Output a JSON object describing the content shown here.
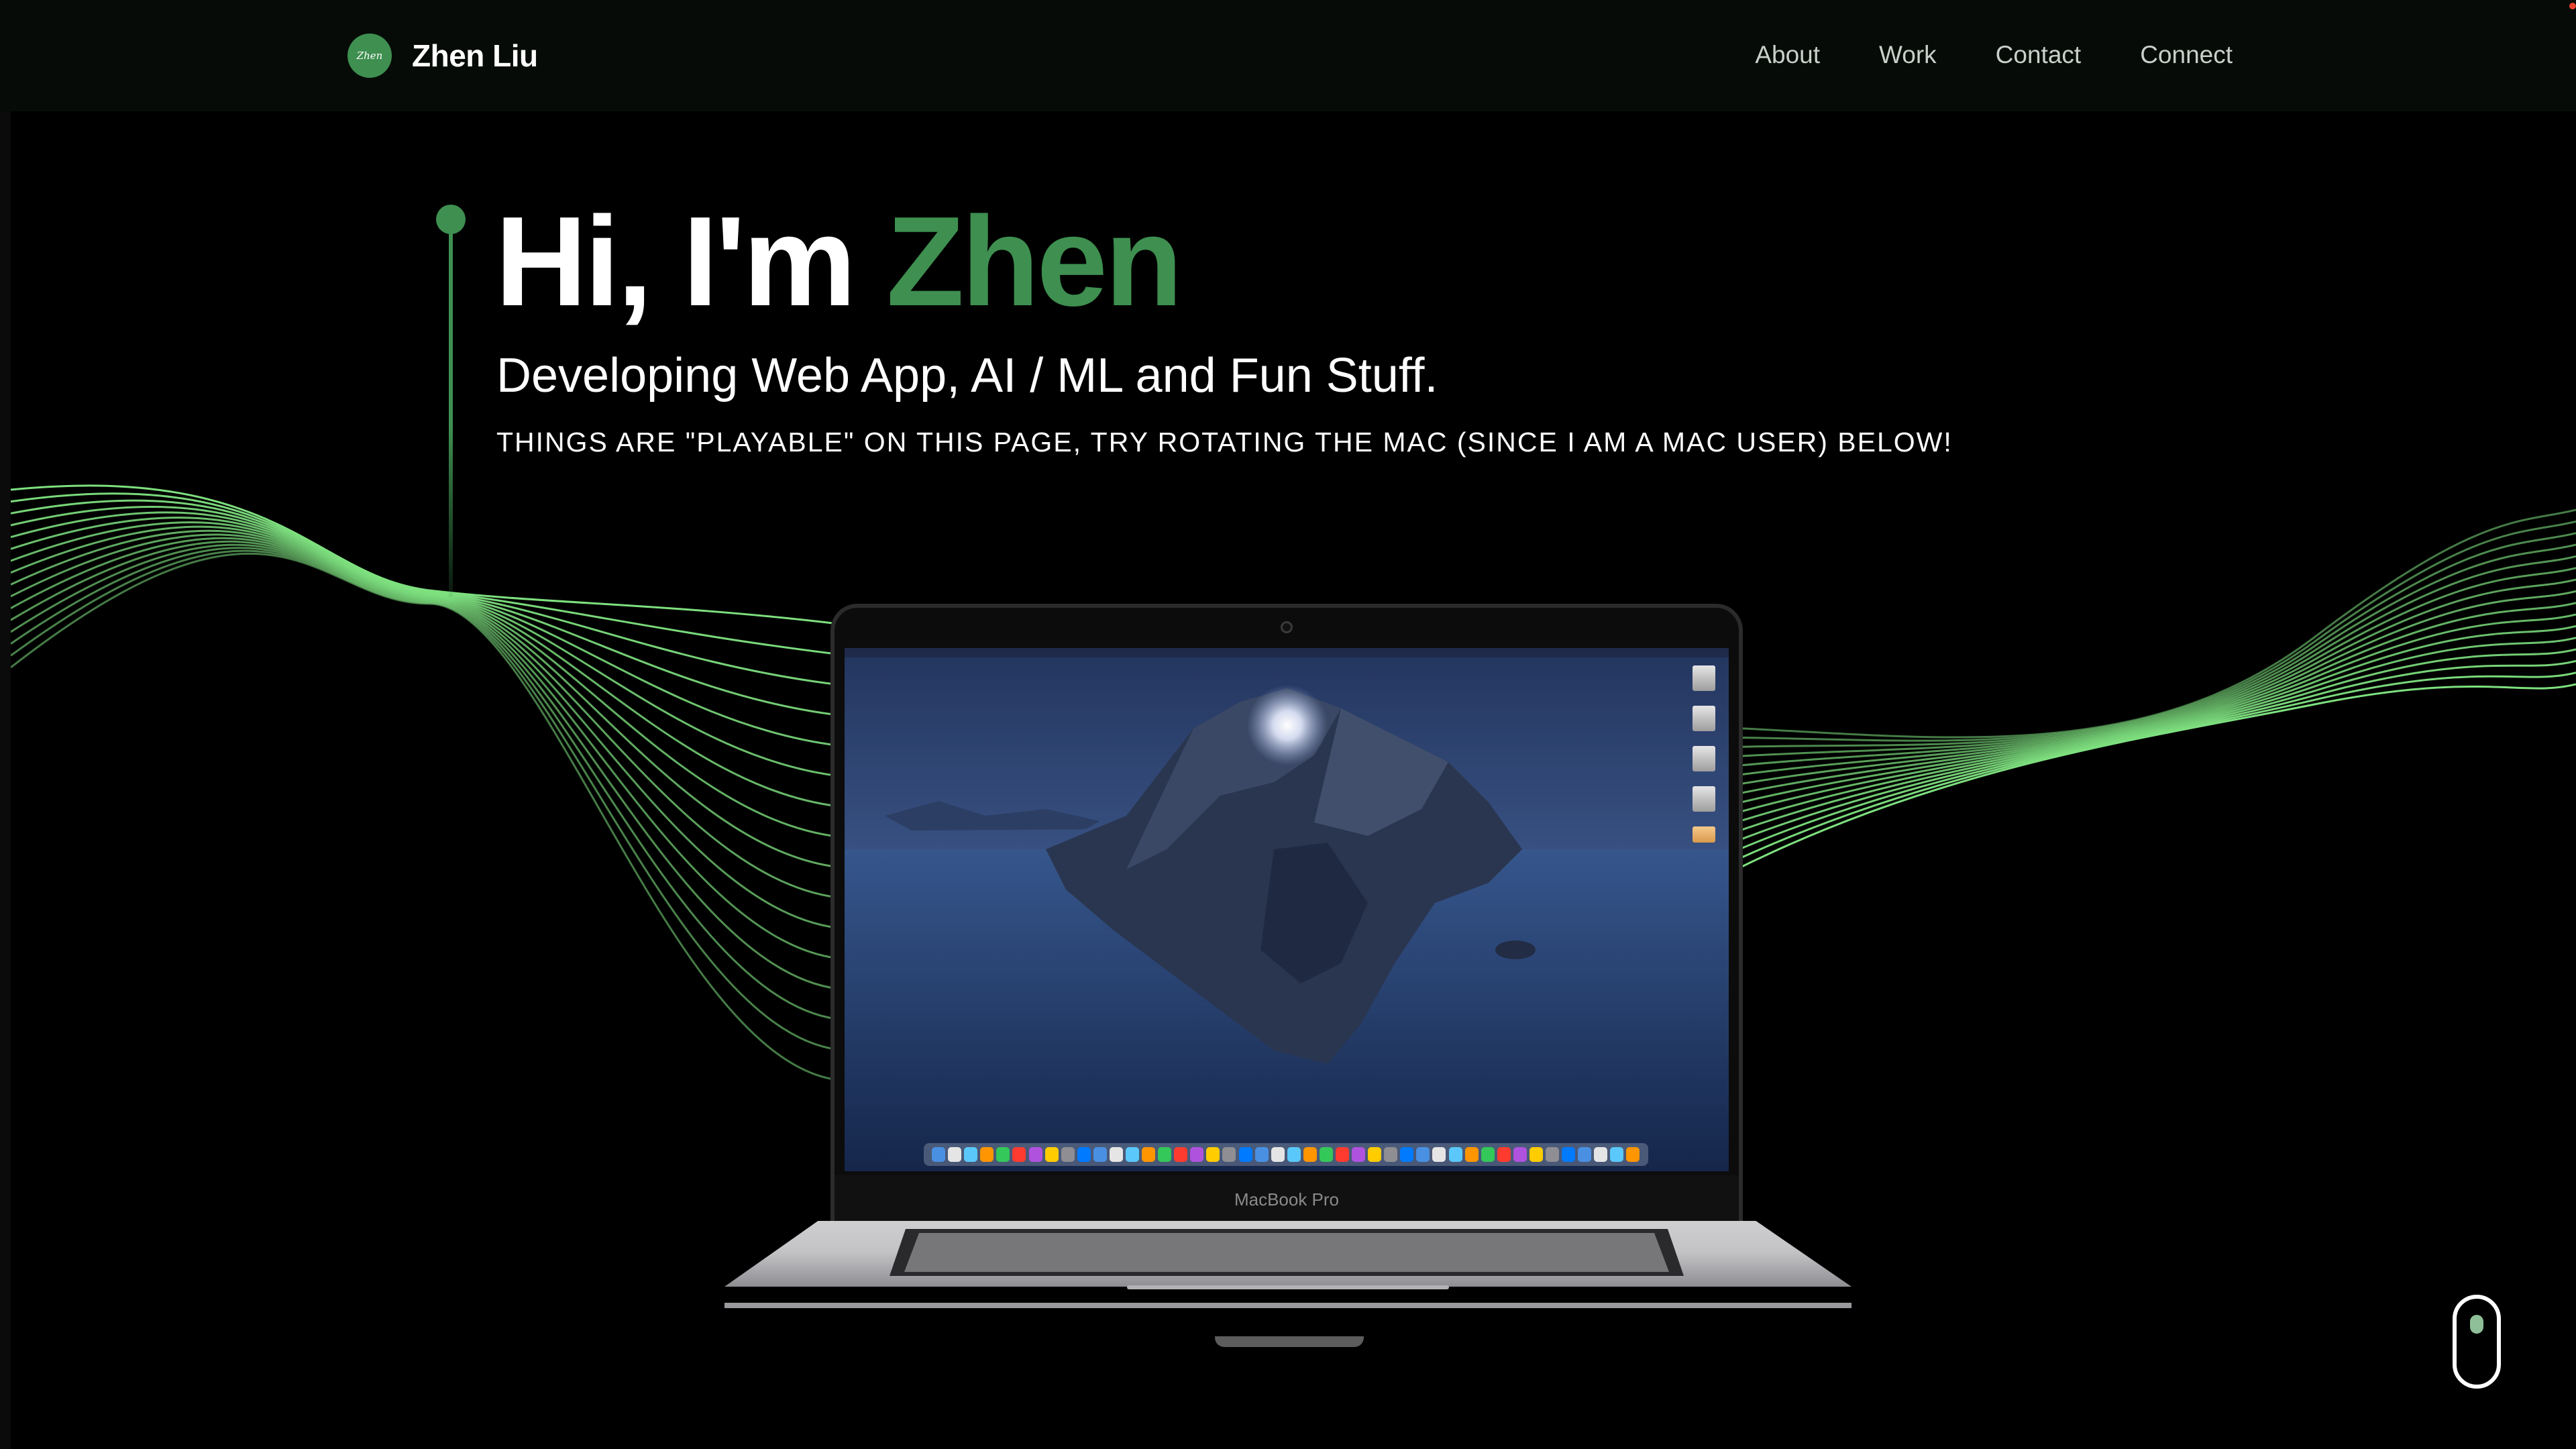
{
  "nav": {
    "logo_text": "Zhen",
    "brand_name": "Zhen Liu",
    "links": [
      {
        "label": "About"
      },
      {
        "label": "Work"
      },
      {
        "label": "Contact"
      },
      {
        "label": "Connect"
      }
    ]
  },
  "hero": {
    "title_prefix": "Hi, I'm ",
    "title_name": "Zhen",
    "subtitle": "Developing Web App, AI / ML and Fun Stuff.",
    "note": "THINGS ARE \"PLAYABLE\" ON THIS PAGE, TRY ROTATING THE MAC (SINCE I AM A MAC USER) BELOW!"
  },
  "laptop": {
    "model_label": "MacBook Pro"
  },
  "icons": {
    "scroll": "mouse-scroll-icon",
    "camera": "camera-icon"
  },
  "colors": {
    "background": "#000000",
    "navbar": "#060b07",
    "accent": "#3e8f50",
    "wave": "#7ee07f",
    "text": "#ffffff",
    "nav_text": "#c9cfc9"
  }
}
